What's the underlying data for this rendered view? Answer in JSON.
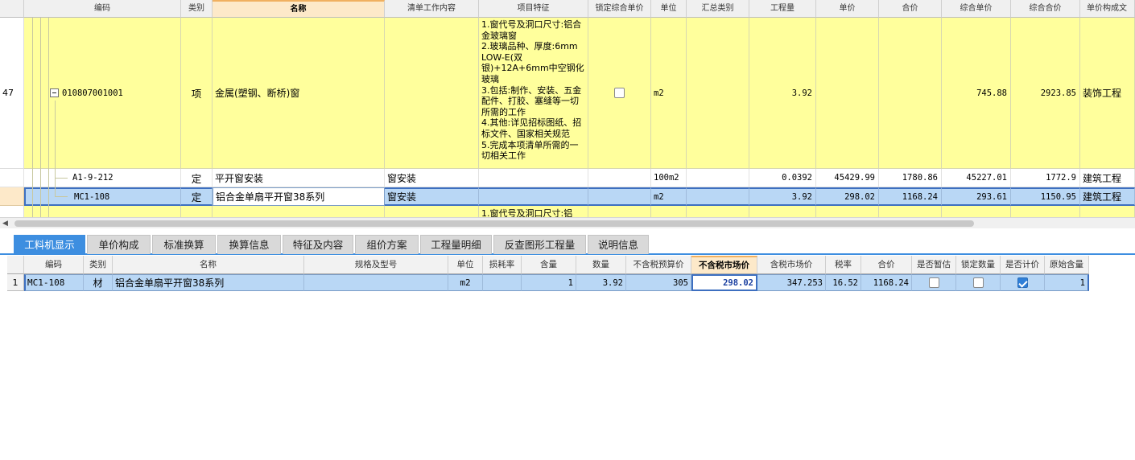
{
  "top_grid": {
    "headers": [
      "编码",
      "类别",
      "名称",
      "清单工作内容",
      "项目特征",
      "锁定综合单价",
      "单位",
      "汇总类别",
      "工程量",
      "单价",
      "合价",
      "综合单价",
      "综合合价",
      "单价构成文"
    ],
    "rows": [
      {
        "rownum": "47",
        "code": "010807001001",
        "type": "项",
        "name": "金属(塑钢、断桥)窗",
        "work": "",
        "feature": "1.窗代号及洞口尺寸:铝合金玻璃窗\n2.玻璃品种、厚度:6mm LOW-E(双银)+12A+6mm中空钢化玻璃\n3.包括:制作、安装、五金配件、打胶、塞缝等一切所需的工作\n4.其他:详见招标图纸、招标文件、国家相关规范\n5.完成本项清单所需的一切相关工作",
        "lock": false,
        "unit": "m2",
        "summary": "",
        "qty": "3.92",
        "price": "",
        "amount": "",
        "comp_price": "745.88",
        "comp_amount": "2923.85",
        "composition": "装饰工程"
      },
      {
        "rownum": "",
        "code": "A1-9-212",
        "type": "定",
        "name": "平开窗安装",
        "work": "窗安装",
        "feature": "",
        "unit": "100m2",
        "summary": "",
        "qty": "0.0392",
        "price": "45429.99",
        "amount": "1780.86",
        "comp_price": "45227.01",
        "comp_amount": "1772.9",
        "composition": "建筑工程"
      },
      {
        "rownum": "",
        "code": "MC1-108",
        "type": "定",
        "name": "铝合金单扇平开窗38系列",
        "work": "窗安装",
        "feature": "",
        "unit": "m2",
        "summary": "",
        "qty": "3.92",
        "price": "298.02",
        "amount": "1168.24",
        "comp_price": "293.61",
        "comp_amount": "1150.95",
        "composition": "建筑工程"
      },
      {
        "feature": "1.窗代号及洞口尺寸:铝"
      }
    ]
  },
  "tabs": [
    "工料机显示",
    "单价构成",
    "标准换算",
    "换算信息",
    "特征及内容",
    "组价方案",
    "工程量明细",
    "反查图形工程量",
    "说明信息"
  ],
  "bottom_grid": {
    "headers": [
      "编码",
      "类别",
      "名称",
      "规格及型号",
      "单位",
      "损耗率",
      "含量",
      "数量",
      "不含税预算价",
      "不含税市场价",
      "含税市场价",
      "税率",
      "合价",
      "是否暂估",
      "锁定数量",
      "是否计价",
      "原始含量"
    ],
    "row": {
      "rownum": "1",
      "code": "MC1-108",
      "type": "材",
      "name": "铝合金单扇平开窗38系列",
      "spec": "",
      "unit": "m2",
      "loss": "",
      "content": "1",
      "qty": "3.92",
      "budget_price": "305",
      "market_price": "298.02",
      "tax_market_price": "347.253",
      "tax_rate": "16.52",
      "amount": "1168.24",
      "provisional": false,
      "lock_qty": false,
      "priced": true,
      "orig_content": "1"
    }
  },
  "colors": {
    "row_yellow": "#ffff9c",
    "row_selected": "#b9d7f5",
    "tab_active": "#3d8ee0",
    "header_active": "#fde9c9"
  }
}
